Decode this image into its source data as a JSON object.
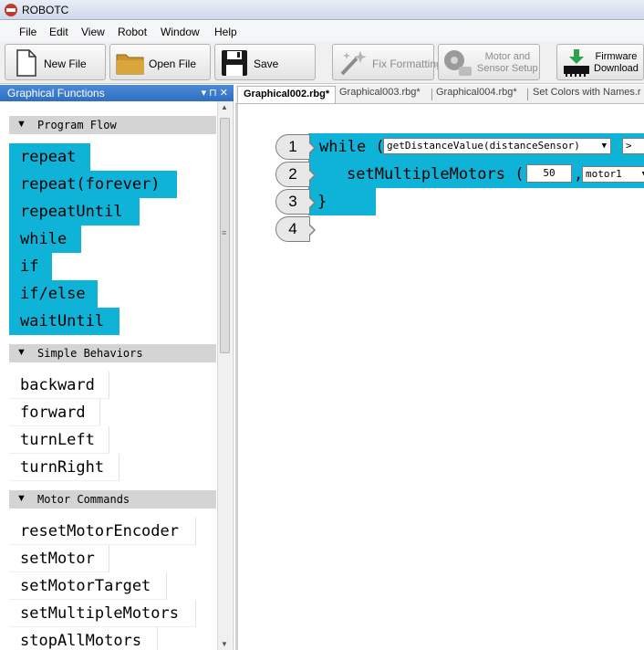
{
  "window": {
    "title": "ROBOTC"
  },
  "menu": [
    "File",
    "Edit",
    "View",
    "Robot",
    "Window",
    "Help"
  ],
  "toolbar": {
    "new_file": "New File",
    "open_file": "Open File",
    "save": "Save",
    "fix_formatting": "Fix Formatting",
    "motor_sensor_line1": "Motor and",
    "motor_sensor_line2": "Sensor Setup",
    "firmware_line1": "Firmware",
    "firmware_line2": "Download"
  },
  "panel": {
    "title": "Graphical Functions",
    "controls": "▾ ⊓ ✕",
    "sections": [
      {
        "title": "Program Flow",
        "items": [
          "repeat",
          "repeat(forever)",
          "repeatUntil",
          "while",
          "if",
          "if/else",
          "waitUntil"
        ]
      },
      {
        "title": "Simple Behaviors",
        "items": [
          "backward",
          "forward",
          "turnLeft",
          "turnRight"
        ]
      },
      {
        "title": "Motor Commands",
        "items": [
          "resetMotorEncoder",
          "setMotor",
          "setMotorTarget",
          "setMultipleMotors",
          "stopAllMotors"
        ]
      }
    ]
  },
  "tabs": [
    "Graphical002.rbg*",
    "Graphical003.rbg*",
    "Graphical004.rbg*",
    "Set Colors with Names.r"
  ],
  "editor": {
    "line_numbers": [
      "1",
      "2",
      "3",
      "4"
    ],
    "while_keyword": "while (",
    "while_condition": "getDistanceValue(distanceSensor)",
    "while_operator": ">",
    "call_name": "setMultipleMotors (",
    "call_value": "50",
    "call_comma": ",",
    "call_motor": "motor1",
    "close_brace": "}"
  },
  "colors": {
    "block_blue": "#0fb3d8",
    "panel_header": "#2f6fc2"
  }
}
